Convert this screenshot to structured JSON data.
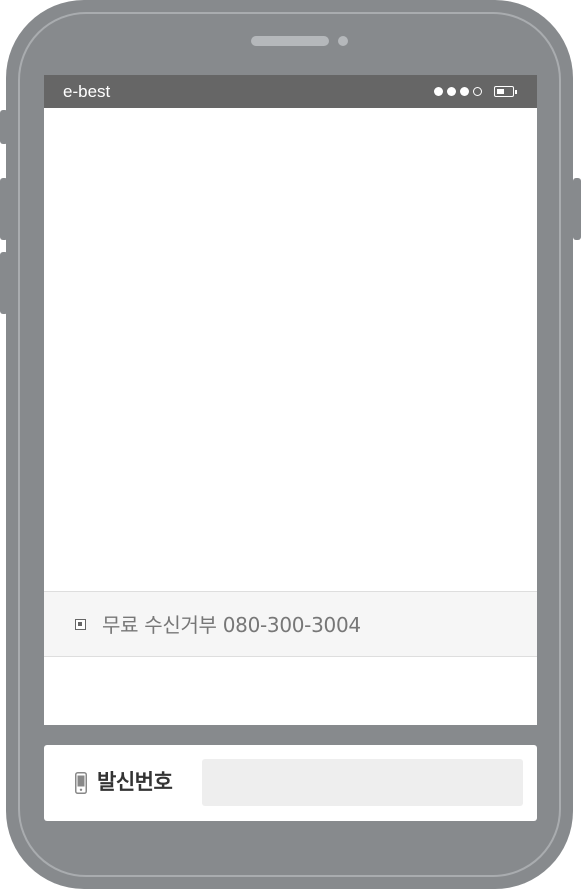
{
  "status_bar": {
    "carrier": "e-best",
    "signal_levels": [
      "on",
      "on",
      "on",
      "off"
    ],
    "battery_level": 0.5
  },
  "message": {
    "opt_out_text": "무료 수신거부 080-300-3004"
  },
  "sender": {
    "label": "발신번호",
    "input_value": "",
    "input_placeholder": ""
  },
  "colors": {
    "phone_body": "#878a8d",
    "status_bar": "#666666",
    "opt_out_bg": "#f6f6f6",
    "input_bg": "#eeeeee"
  },
  "icons": {
    "opt_out": "square-bullet-icon",
    "sender": "mobile-phone-icon"
  }
}
